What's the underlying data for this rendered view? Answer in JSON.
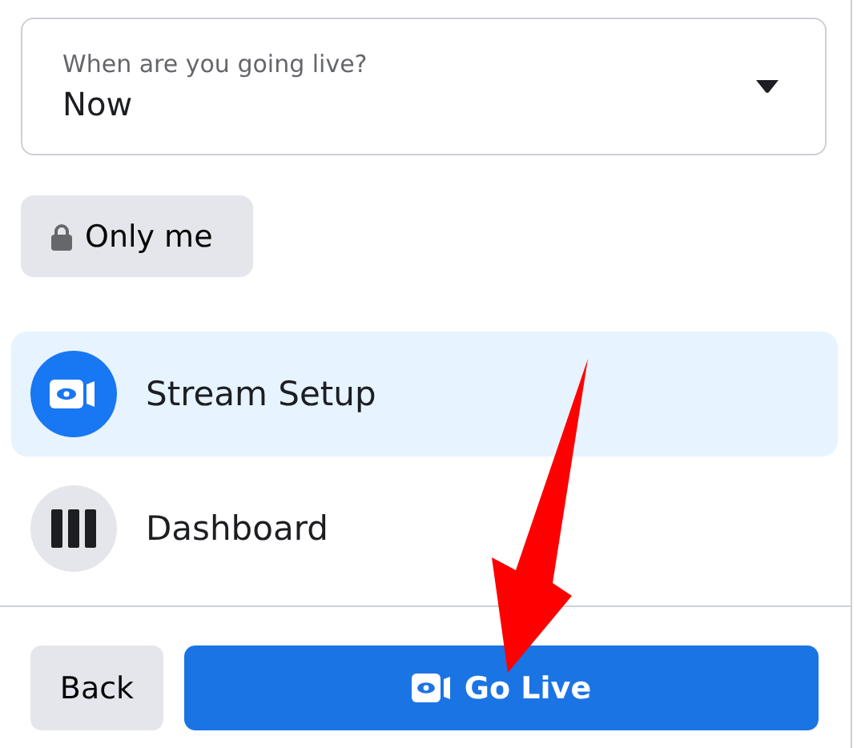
{
  "schedule": {
    "label": "When are you going live?",
    "value": "Now"
  },
  "audience": {
    "label": "Only me"
  },
  "menu": [
    {
      "kind": "stream",
      "label": "Stream Setup",
      "selected": true
    },
    {
      "kind": "dashboard",
      "label": "Dashboard",
      "selected": false
    }
  ],
  "footer": {
    "back": "Back",
    "go_live": "Go Live"
  }
}
